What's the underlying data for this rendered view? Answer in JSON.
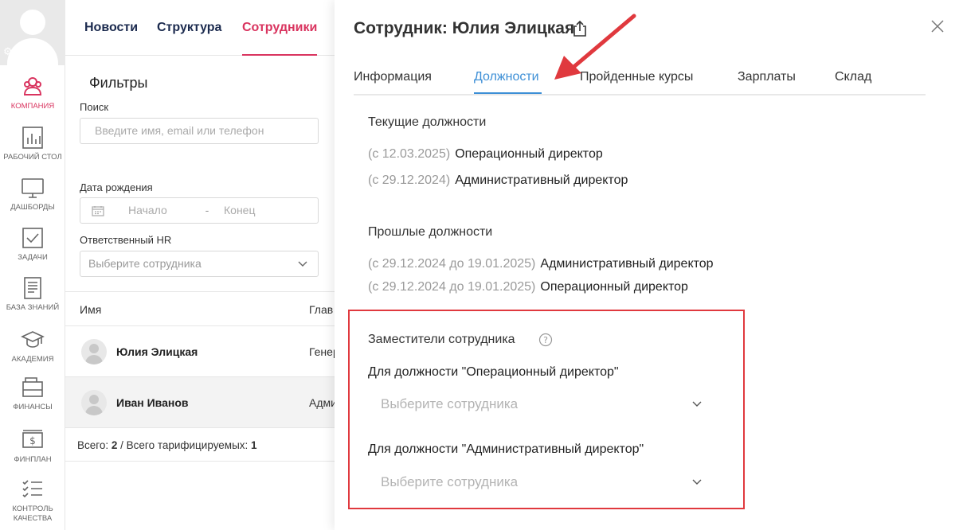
{
  "rail": {
    "items": [
      {
        "label": "КОМПАНИЯ",
        "icon": "company-icon",
        "active": true
      },
      {
        "label": "РАБОЧИЙ СТОЛ",
        "icon": "desktop-chart-icon"
      },
      {
        "label": "ДАШБОРДЫ",
        "icon": "monitor-icon"
      },
      {
        "label": "ЗАДАЧИ",
        "icon": "checkbox-icon"
      },
      {
        "label": "БАЗА ЗНАНИЙ",
        "icon": "document-icon"
      },
      {
        "label": "АКАДЕМИЯ",
        "icon": "graduation-cap-icon"
      },
      {
        "label": "ФИНАНСЫ",
        "icon": "wallet-icon"
      },
      {
        "label": "ФИНПЛАН",
        "icon": "money-icon"
      },
      {
        "label": "КОНТРОЛЬ КАЧЕСТВА",
        "icon": "checklist-icon"
      }
    ]
  },
  "topnav": {
    "tabs": [
      {
        "label": "Новости"
      },
      {
        "label": "Структура"
      },
      {
        "label": "Сотрудники",
        "active": true
      }
    ]
  },
  "filters": {
    "title": "Фильтры",
    "search_label": "Поиск",
    "search_placeholder": "Введите имя, email или телефон",
    "birth_label": "Дата рождения",
    "birth_start": "Начало",
    "birth_sep": "-",
    "birth_end": "Конец",
    "hr_label": "Ответственный HR",
    "hr_placeholder": "Выберите сотрудника"
  },
  "table": {
    "col_name": "Имя",
    "col_pos": "Глав",
    "rows": [
      {
        "name": "Юлия Элицкая",
        "role": "Генер"
      },
      {
        "name": "Иван Иванов",
        "role": "Адми"
      }
    ],
    "totals_prefix": "Всего: ",
    "totals_count": "2",
    "totals_mid": " / Всего тарифицируемых: ",
    "totals_billable": "1"
  },
  "panel": {
    "title": "Сотрудник: Юлия Элицкая",
    "tabs": [
      {
        "label": "Информация"
      },
      {
        "label": "Должности",
        "active": true
      },
      {
        "label": "Пройденные курсы"
      },
      {
        "label": "Зарплаты"
      },
      {
        "label": "Склад"
      }
    ],
    "current_title": "Текущие должности",
    "current": [
      {
        "date": "(с 12.03.2025)",
        "position": "Операционный директор"
      },
      {
        "date": "(с 29.12.2024)",
        "position": "Административный директор"
      }
    ],
    "past_title": "Прошлые должности",
    "past": [
      {
        "date": "(с 29.12.2024 до 19.01.2025)",
        "position": "Административный директор"
      },
      {
        "date": "(с 29.12.2024 до 19.01.2025)",
        "position": "Операционный директор"
      }
    ],
    "deputies_title": "Заместители сотрудника",
    "deputies": [
      {
        "label": "Для должности \"Операционный директор\"",
        "placeholder": "Выберите сотрудника"
      },
      {
        "label": "Для должности \"Административный директор\"",
        "placeholder": "Выберите сотрудника"
      }
    ]
  },
  "colors": {
    "accent_pink": "#d9345f",
    "accent_blue": "#3d8fd6",
    "nav_dark": "#1b2a4e",
    "highlight_red": "#e0393e"
  }
}
